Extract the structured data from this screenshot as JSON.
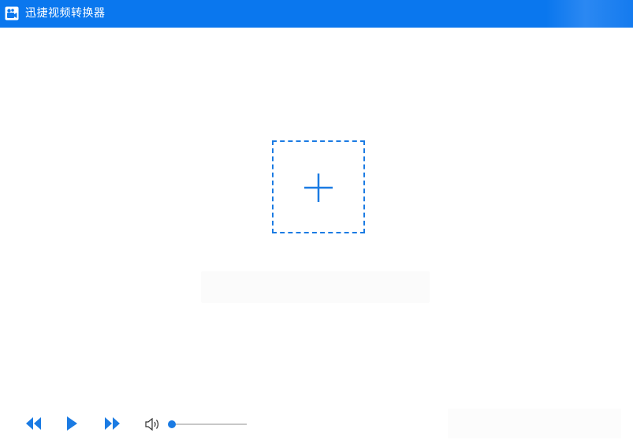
{
  "window": {
    "title": "迅捷视频转换器",
    "accent": "#0a77ee",
    "logo_icon": "app-logo-icon"
  },
  "main": {
    "add_button_icon": "plus-icon",
    "add_button_color": "#1b7be3"
  },
  "player": {
    "controls": [
      {
        "name": "rewind",
        "icon": "rewind-icon"
      },
      {
        "name": "play",
        "icon": "play-icon"
      },
      {
        "name": "forward",
        "icon": "fast-forward-icon"
      },
      {
        "name": "volume",
        "icon": "speaker-icon"
      }
    ],
    "volume_level": 0
  }
}
